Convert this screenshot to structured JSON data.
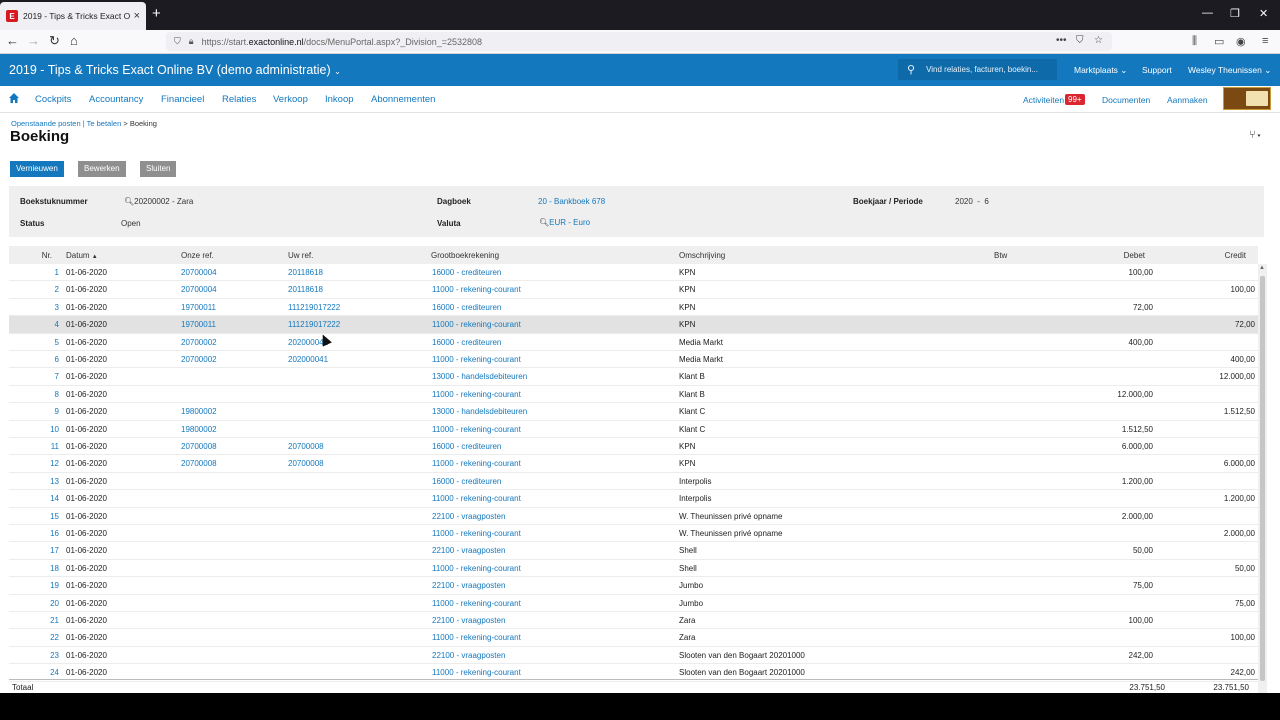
{
  "browser": {
    "tab_title": "2019 - Tips & Tricks Exact Onli",
    "url_prefix": "https://start.",
    "url_domain": "exactonline.nl",
    "url_path": "/docs/MenuPortal.aspx?_Division_=2532808"
  },
  "app": {
    "title": "2019 - Tips & Tricks Exact Online BV (demo administratie)",
    "search_placeholder": "Vind relaties, facturen, boekin...",
    "header_links": [
      "Marktplaats",
      "Support",
      "Wesley Theunissen"
    ]
  },
  "menu": {
    "items": [
      "Cockpits",
      "Accountancy",
      "Financieel",
      "Relaties",
      "Verkoop",
      "Inkoop",
      "Abonnementen"
    ],
    "activities_label": "Activiteiten",
    "activities_badge": "99+",
    "documents_label": "Documenten",
    "create_label": "Aanmaken"
  },
  "breadcrumb": {
    "part1": "Openstaande posten",
    "sep1": " | ",
    "part2": "Te betalen",
    "sep2": " > ",
    "current": "Boeking"
  },
  "page_title": "Boeking",
  "buttons": {
    "refresh": "Vernieuwen",
    "edit": "Bewerken",
    "close": "Sluiten"
  },
  "info": {
    "entry_number_label": "Boekstuknummer",
    "entry_number_value": "20200002 - Zara",
    "journal_label": "Dagboek",
    "journal_value": "20 - Bankboek 678",
    "year_period_label": "Boekjaar / Periode",
    "year_value": "2020",
    "period_sep": "-",
    "period_value": "6",
    "status_label": "Status",
    "status_value": "Open",
    "currency_label": "Valuta",
    "currency_value": "EUR - Euro"
  },
  "table": {
    "headers": {
      "nr": "Nr.",
      "date": "Datum",
      "sort_arrow": "▲",
      "our_ref": "Onze ref.",
      "your_ref": "Uw ref.",
      "gl": "Grootboekrekening",
      "description": "Omschrijving",
      "vat": "Btw",
      "debit": "Debet",
      "credit": "Credit"
    },
    "rows": [
      {
        "nr": "1",
        "date": "01-06-2020",
        "our_ref": "20700004",
        "your_ref": "20118618",
        "gl": "16000 - crediteuren",
        "desc": "KPN",
        "debit": "100,00",
        "credit": ""
      },
      {
        "nr": "2",
        "date": "01-06-2020",
        "our_ref": "20700004",
        "your_ref": "20118618",
        "gl": "11000 - rekening-courant",
        "desc": "KPN",
        "debit": "",
        "credit": "100,00"
      },
      {
        "nr": "3",
        "date": "01-06-2020",
        "our_ref": "19700011",
        "your_ref": "111219017222",
        "gl": "16000 - crediteuren",
        "desc": "KPN",
        "debit": "72,00",
        "credit": ""
      },
      {
        "nr": "4",
        "date": "01-06-2020",
        "our_ref": "19700011",
        "your_ref": "111219017222",
        "gl": "11000 - rekening-courant",
        "desc": "KPN",
        "debit": "",
        "credit": "72,00"
      },
      {
        "nr": "5",
        "date": "01-06-2020",
        "our_ref": "20700002",
        "your_ref": "202000041",
        "gl": "16000 - crediteuren",
        "desc": "Media Markt",
        "debit": "400,00",
        "credit": ""
      },
      {
        "nr": "6",
        "date": "01-06-2020",
        "our_ref": "20700002",
        "your_ref": "202000041",
        "gl": "11000 - rekening-courant",
        "desc": "Media Markt",
        "debit": "",
        "credit": "400,00"
      },
      {
        "nr": "7",
        "date": "01-06-2020",
        "our_ref": "",
        "your_ref": "",
        "gl": "13000 - handelsdebiteuren",
        "desc": "Klant B",
        "debit": "",
        "credit": "12.000,00"
      },
      {
        "nr": "8",
        "date": "01-06-2020",
        "our_ref": "",
        "your_ref": "",
        "gl": "11000 - rekening-courant",
        "desc": "Klant B",
        "debit": "12.000,00",
        "credit": ""
      },
      {
        "nr": "9",
        "date": "01-06-2020",
        "our_ref": "19800002",
        "your_ref": "",
        "gl": "13000 - handelsdebiteuren",
        "desc": "Klant C",
        "debit": "",
        "credit": "1.512,50"
      },
      {
        "nr": "10",
        "date": "01-06-2020",
        "our_ref": "19800002",
        "your_ref": "",
        "gl": "11000 - rekening-courant",
        "desc": "Klant C",
        "debit": "1.512,50",
        "credit": ""
      },
      {
        "nr": "11",
        "date": "01-06-2020",
        "our_ref": "20700008",
        "your_ref": "20700008",
        "gl": "16000 - crediteuren",
        "desc": "KPN",
        "debit": "6.000,00",
        "credit": ""
      },
      {
        "nr": "12",
        "date": "01-06-2020",
        "our_ref": "20700008",
        "your_ref": "20700008",
        "gl": "11000 - rekening-courant",
        "desc": "KPN",
        "debit": "",
        "credit": "6.000,00"
      },
      {
        "nr": "13",
        "date": "01-06-2020",
        "our_ref": "",
        "your_ref": "",
        "gl": "16000 - crediteuren",
        "desc": "Interpolis",
        "debit": "1.200,00",
        "credit": ""
      },
      {
        "nr": "14",
        "date": "01-06-2020",
        "our_ref": "",
        "your_ref": "",
        "gl": "11000 - rekening-courant",
        "desc": "Interpolis",
        "debit": "",
        "credit": "1.200,00"
      },
      {
        "nr": "15",
        "date": "01-06-2020",
        "our_ref": "",
        "your_ref": "",
        "gl": "22100 - vraagposten",
        "desc": "W. Theunissen privé opname",
        "debit": "2.000,00",
        "credit": ""
      },
      {
        "nr": "16",
        "date": "01-06-2020",
        "our_ref": "",
        "your_ref": "",
        "gl": "11000 - rekening-courant",
        "desc": "W. Theunissen privé opname",
        "debit": "",
        "credit": "2.000,00"
      },
      {
        "nr": "17",
        "date": "01-06-2020",
        "our_ref": "",
        "your_ref": "",
        "gl": "22100 - vraagposten",
        "desc": "Shell",
        "debit": "50,00",
        "credit": ""
      },
      {
        "nr": "18",
        "date": "01-06-2020",
        "our_ref": "",
        "your_ref": "",
        "gl": "11000 - rekening-courant",
        "desc": "Shell",
        "debit": "",
        "credit": "50,00"
      },
      {
        "nr": "19",
        "date": "01-06-2020",
        "our_ref": "",
        "your_ref": "",
        "gl": "22100 - vraagposten",
        "desc": "Jumbo",
        "debit": "75,00",
        "credit": ""
      },
      {
        "nr": "20",
        "date": "01-06-2020",
        "our_ref": "",
        "your_ref": "",
        "gl": "11000 - rekening-courant",
        "desc": "Jumbo",
        "debit": "",
        "credit": "75,00"
      },
      {
        "nr": "21",
        "date": "01-06-2020",
        "our_ref": "",
        "your_ref": "",
        "gl": "22100 - vraagposten",
        "desc": "Zara",
        "debit": "100,00",
        "credit": ""
      },
      {
        "nr": "22",
        "date": "01-06-2020",
        "our_ref": "",
        "your_ref": "",
        "gl": "11000 - rekening-courant",
        "desc": "Zara",
        "debit": "",
        "credit": "100,00"
      },
      {
        "nr": "23",
        "date": "01-06-2020",
        "our_ref": "",
        "your_ref": "",
        "gl": "22100 - vraagposten",
        "desc": "Slooten van den Bogaart 20201000",
        "debit": "242,00",
        "credit": ""
      },
      {
        "nr": "24",
        "date": "01-06-2020",
        "our_ref": "",
        "your_ref": "",
        "gl": "11000 - rekening-courant",
        "desc": "Slooten van den Bogaart 20201000",
        "debit": "",
        "credit": "242,00"
      }
    ],
    "highlighted_row": 4,
    "total_label": "Totaal",
    "total_debit": "23.751,50",
    "total_credit": "23.751,50"
  },
  "colors": {
    "brand_blue": "#1478be",
    "badge_red": "#d9262f",
    "highlight_row": "#e2e2e2"
  }
}
